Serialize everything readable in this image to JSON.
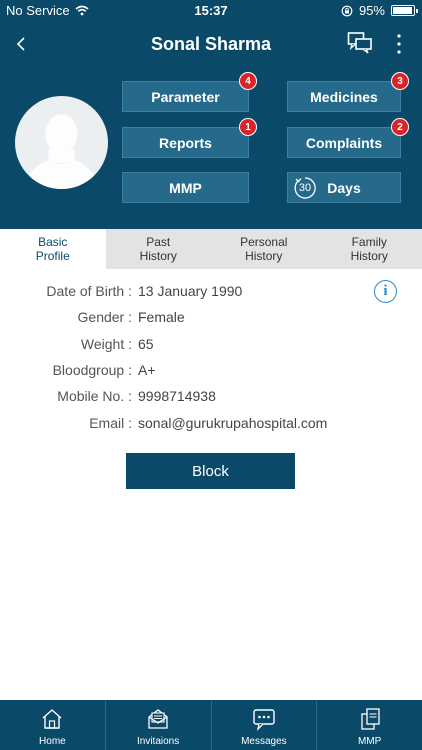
{
  "status_bar": {
    "carrier": "No Service",
    "time": "15:37",
    "battery": "95%",
    "battery_level": 0.95
  },
  "navbar": {
    "title": "Sonal Sharma"
  },
  "actions": {
    "parameter": {
      "label": "Parameter",
      "badge": "4"
    },
    "medicines": {
      "label": "Medicines",
      "badge": "3"
    },
    "reports": {
      "label": "Reports",
      "badge": "1"
    },
    "complaints": {
      "label": "Complaints",
      "badge": "2"
    },
    "mmp": {
      "label": "MMP"
    },
    "days": {
      "label": "Days",
      "count": "30"
    }
  },
  "tabs": [
    {
      "line1": "Basic",
      "line2": "Profile",
      "active": true
    },
    {
      "line1": "Past",
      "line2": "History",
      "active": false
    },
    {
      "line1": "Personal",
      "line2": "History",
      "active": false
    },
    {
      "line1": "Family",
      "line2": "History",
      "active": false
    }
  ],
  "profile": {
    "dob_label": "Date of Birth :",
    "dob": "13 January 1990",
    "gender_label": "Gender :",
    "gender": "Female",
    "weight_label": "Weight :",
    "weight": "65",
    "bloodgroup_label": "Bloodgroup :",
    "bloodgroup": "A+",
    "mobile_label": "Mobile No. :",
    "mobile": "9998714938",
    "email_label": "Email :",
    "email": "sonal@gurukrupahospital.com"
  },
  "block_button": "Block",
  "bottom_tabs": {
    "home": "Home",
    "invitations": "Invitaions",
    "messages": "Messages",
    "mmp": "MMP"
  },
  "colors": {
    "primary": "#0a4a68",
    "button": "#266a8b",
    "badge": "#d9242a",
    "info": "#2a8bc8"
  },
  "icons": [
    "back-chevron-icon",
    "chat-icon",
    "more-vertical-icon",
    "avatar-placeholder-icon",
    "refresh-circle-icon",
    "info-icon",
    "home-icon",
    "invitation-envelope-icon",
    "message-bubble-icon",
    "mmp-document-icon",
    "wifi-icon",
    "rotation-lock-icon"
  ]
}
